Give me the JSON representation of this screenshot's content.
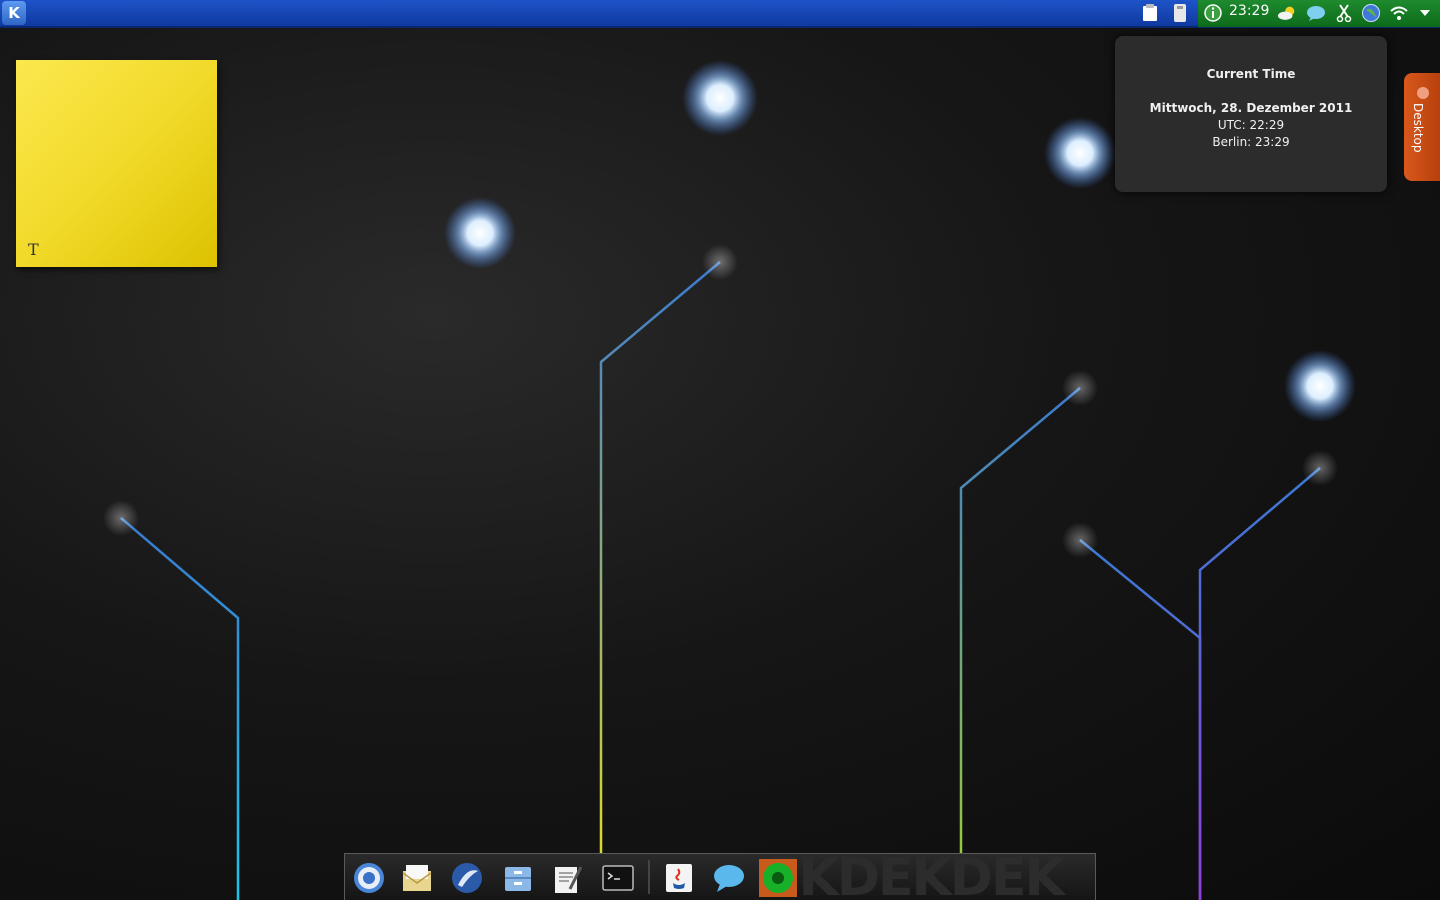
{
  "top_panel": {
    "launcher_icon": "kde-logo-icon",
    "launcher_glyph": "K",
    "tray": {
      "icons": [
        "clipboard-icon",
        "device-notifier-icon",
        "info-icon",
        "weather-icon",
        "chat-bubble-icon",
        "scissors-icon",
        "network-globe-icon",
        "wifi-icon",
        "expand-arrow-icon"
      ],
      "clock": "23:29"
    },
    "colors": {
      "panel": "#1e54c8",
      "tray": "#1e8a2e"
    }
  },
  "sticky_note": {
    "format_glyph": "T",
    "color": "#f2da2a"
  },
  "clock_tooltip": {
    "title": "Current Time",
    "date": "Mittwoch, 28. Dezember 2011",
    "utc": "UTC: 22:29",
    "berlin": "Berlin: 23:29"
  },
  "desktop_toolbox": {
    "label": "Desktop",
    "color": "#d8581c"
  },
  "dock": {
    "watermark": "EKDEKDEK",
    "items": [
      "chromium-icon",
      "mail-icon",
      "thunderbird-icon",
      "file-manager-icon",
      "text-editor-icon",
      "terminal-icon",
      "java-icon",
      "chat-icon",
      "green-app-icon"
    ]
  }
}
